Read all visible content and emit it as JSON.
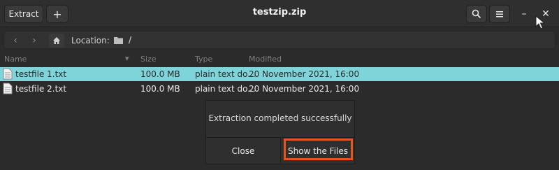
{
  "header": {
    "extract_label": "Extract",
    "add_label": "+",
    "title": "testzip.zip",
    "icons": [
      "search-icon",
      "hamburger-menu-icon",
      "minimize-icon",
      "close-icon"
    ],
    "minimize_glyph": "–",
    "close_glyph": "✕"
  },
  "location": {
    "label": "Location:",
    "path": "/",
    "back_glyph": "‹",
    "forward_glyph": "›"
  },
  "table": {
    "columns": [
      "Name",
      "Size",
      "Type",
      "Modified"
    ],
    "sort_glyph": "▾",
    "rows": [
      {
        "name": "testfile 1.txt",
        "size": "100.0 MB",
        "type": "plain text do...",
        "modified": "20 November 2021, 16:00",
        "selected": true
      },
      {
        "name": "testfile 2.txt",
        "size": "100.0 MB",
        "type": "plain text do...",
        "modified": "20 November 2021, 16:00",
        "selected": false
      }
    ]
  },
  "dialog": {
    "message": "Extraction completed successfully",
    "close_label": "Close",
    "show_files_label": "Show the Files"
  },
  "colors": {
    "selected_row": "#7fd4d9",
    "highlight_border": "#e8531f",
    "background": "#2b2b2b"
  }
}
